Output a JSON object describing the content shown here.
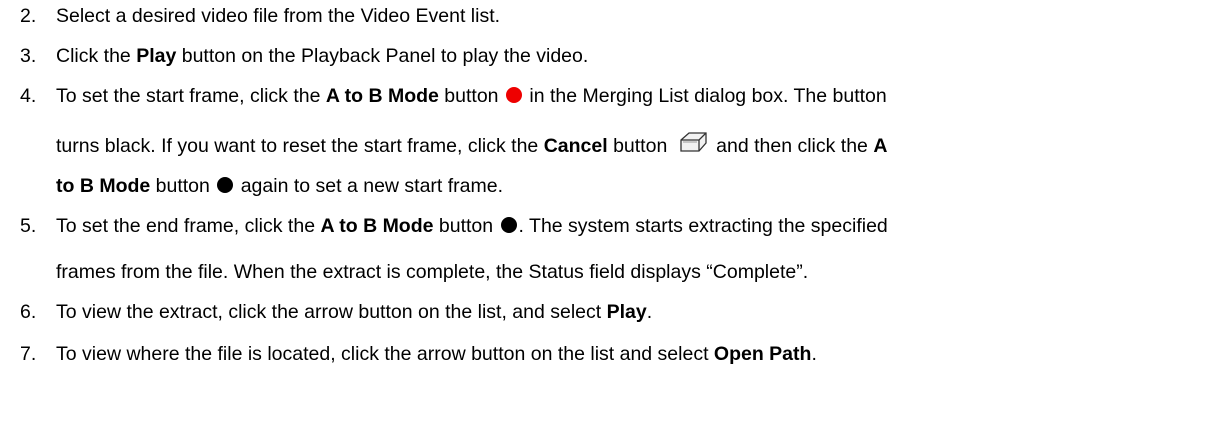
{
  "steps": [
    {
      "number": "2.",
      "lines": [
        [
          {
            "text": "Select a desired video file from the Video Event list."
          }
        ]
      ]
    },
    {
      "number": "3.",
      "lines": [
        [
          {
            "text": "Click the "
          },
          {
            "text": "Play",
            "bold": true
          },
          {
            "text": " button on the Playback Panel to play the video."
          }
        ]
      ]
    },
    {
      "number": "4.",
      "lines": [
        [
          {
            "text": "To set the start frame, click the "
          },
          {
            "text": "A to B Mode",
            "bold": true
          },
          {
            "text": " button "
          },
          {
            "icon": "red-record-dot-icon"
          },
          {
            "text": " in the Merging List dialog box. The button"
          }
        ],
        [
          {
            "text": "turns black. If you want to reset the start frame, click the "
          },
          {
            "text": "Cancel",
            "bold": true
          },
          {
            "text": " button "
          },
          {
            "icon": "eraser-icon"
          },
          {
            "text": " and then click the "
          },
          {
            "text": "A",
            "bold": true
          }
        ],
        [
          {
            "text": "to B Mode",
            "bold": true
          },
          {
            "text": " button "
          },
          {
            "icon": "black-record-dot-icon"
          },
          {
            "text": " again to set a new start frame."
          }
        ]
      ]
    },
    {
      "number": "5.",
      "lines": [
        [
          {
            "text": "To set the end frame, click the "
          },
          {
            "text": "A to B Mode",
            "bold": true
          },
          {
            "text": " button "
          },
          {
            "icon": "black-record-dot-icon"
          },
          {
            "text": ". The system starts extracting the specified"
          }
        ],
        [
          {
            "text": "frames from the file. When the extract is complete, the Status field displays “Complete”."
          }
        ]
      ]
    },
    {
      "number": "6.",
      "lines": [
        [
          {
            "text": "To view the extract, click the arrow button on the list, and select "
          },
          {
            "text": "Play",
            "bold": true
          },
          {
            "text": "."
          }
        ]
      ]
    },
    {
      "number": "7.",
      "lines": [
        [
          {
            "text": "To view where the file is located, click the arrow button on the list and select "
          },
          {
            "text": "Open Path",
            "bold": true
          },
          {
            "text": "."
          }
        ]
      ]
    }
  ],
  "colors": {
    "text": "#000000",
    "red_dot": "#ee0000",
    "black_dot": "#000000",
    "background": "#ffffff"
  }
}
